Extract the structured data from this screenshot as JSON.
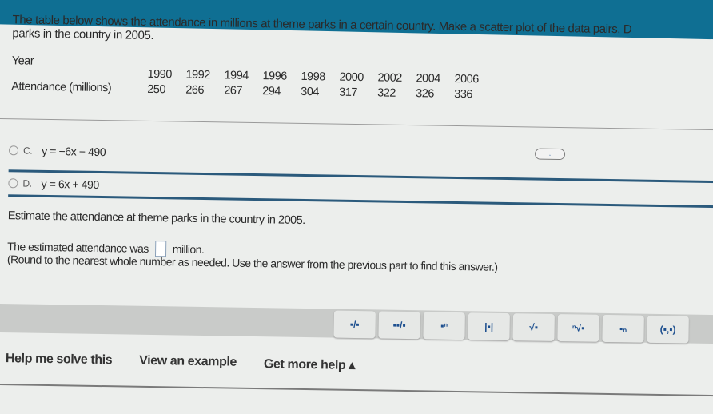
{
  "header": {
    "accent_color": "#0f6f93"
  },
  "question": {
    "intro": "The table below shows the attendance in millions at theme parks in a certain country. Make a scatter plot of the data pairs. D",
    "intro_line2": "parks in the country in 2005.",
    "table": {
      "row1_label": "Year",
      "row2_label": "Attendance (millions)",
      "years": [
        "1990",
        "1992",
        "1994",
        "1996",
        "1998",
        "2000",
        "2002",
        "2004",
        "2006"
      ],
      "attendance": [
        "250",
        "266",
        "267",
        "294",
        "304",
        "317",
        "322",
        "326",
        "336"
      ]
    },
    "more_label": "...",
    "options": [
      {
        "letter": "C.",
        "equation": "y = −6x − 490"
      },
      {
        "letter": "D.",
        "equation": "y = 6x + 490"
      }
    ],
    "estimate_prompt": "Estimate the attendance at theme parks in the country in 2005.",
    "answer_prefix": "The estimated attendance was",
    "answer_value": "",
    "answer_suffix": "million.",
    "round_note": "(Round to the nearest whole number as needed. Use the answer from the previous part to find this answer.)"
  },
  "math_toolbar": [
    {
      "name": "fraction",
      "glyph": "▪/▪"
    },
    {
      "name": "mixed-number",
      "glyph": "▪▪/▪"
    },
    {
      "name": "exponent",
      "glyph": "▪ⁿ"
    },
    {
      "name": "absolute-value",
      "glyph": "|▪|"
    },
    {
      "name": "square-root",
      "glyph": "√▪"
    },
    {
      "name": "nth-root",
      "glyph": "ⁿ√▪"
    },
    {
      "name": "subscript",
      "glyph": "▪ₙ"
    },
    {
      "name": "ordered-pair",
      "glyph": "(▪,▪)"
    }
  ],
  "help": {
    "help_me": "Help me solve this",
    "example": "View an example",
    "more_help": "Get more help ▴"
  }
}
